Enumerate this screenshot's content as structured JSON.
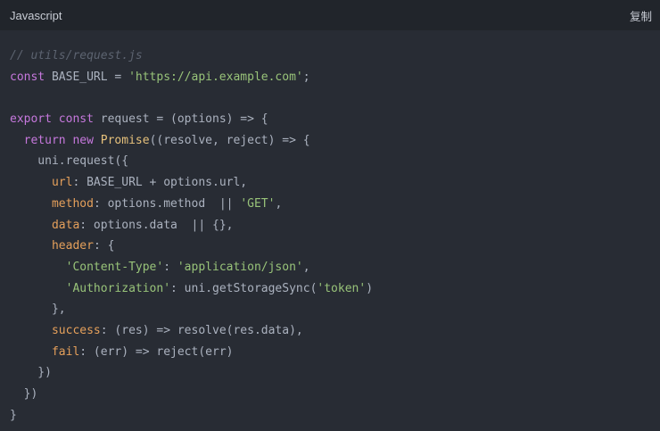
{
  "header": {
    "language": "Javascript",
    "copy_label": "复制"
  },
  "colors": {
    "background": "#282c34",
    "header_background": "#21252b",
    "comment": "#5c6370",
    "keyword": "#c678dd",
    "string": "#98c379",
    "property": "#e5a05b",
    "class": "#e5c07b",
    "plain": "#abb2bf"
  },
  "code": {
    "lines": [
      [
        {
          "t": "comment",
          "v": "// utils/request.js"
        }
      ],
      [
        {
          "t": "keyword",
          "v": "const"
        },
        {
          "t": "plain",
          "v": " BASE_URL = "
        },
        {
          "t": "string",
          "v": "'https://api.example.com'"
        },
        {
          "t": "plain",
          "v": ";"
        }
      ],
      [],
      [
        {
          "t": "keyword",
          "v": "export"
        },
        {
          "t": "plain",
          "v": " "
        },
        {
          "t": "keyword",
          "v": "const"
        },
        {
          "t": "plain",
          "v": " request = (options) => {"
        }
      ],
      [
        {
          "t": "plain",
          "v": "  "
        },
        {
          "t": "keyword",
          "v": "return"
        },
        {
          "t": "plain",
          "v": " "
        },
        {
          "t": "keyword",
          "v": "new"
        },
        {
          "t": "plain",
          "v": " "
        },
        {
          "t": "class",
          "v": "Promise"
        },
        {
          "t": "plain",
          "v": "((resolve, reject) => {"
        }
      ],
      [
        {
          "t": "plain",
          "v": "    uni.request({"
        }
      ],
      [
        {
          "t": "plain",
          "v": "      "
        },
        {
          "t": "prop",
          "v": "url"
        },
        {
          "t": "plain",
          "v": ": BASE_URL + options.url,"
        }
      ],
      [
        {
          "t": "plain",
          "v": "      "
        },
        {
          "t": "prop",
          "v": "method"
        },
        {
          "t": "plain",
          "v": ": options.method  || "
        },
        {
          "t": "string",
          "v": "'GET'"
        },
        {
          "t": "plain",
          "v": ","
        }
      ],
      [
        {
          "t": "plain",
          "v": "      "
        },
        {
          "t": "prop",
          "v": "data"
        },
        {
          "t": "plain",
          "v": ": options.data  || {},"
        }
      ],
      [
        {
          "t": "plain",
          "v": "      "
        },
        {
          "t": "prop",
          "v": "header"
        },
        {
          "t": "plain",
          "v": ": {"
        }
      ],
      [
        {
          "t": "plain",
          "v": "        "
        },
        {
          "t": "string",
          "v": "'Content-Type'"
        },
        {
          "t": "plain",
          "v": ": "
        },
        {
          "t": "string",
          "v": "'application/json'"
        },
        {
          "t": "plain",
          "v": ","
        }
      ],
      [
        {
          "t": "plain",
          "v": "        "
        },
        {
          "t": "string",
          "v": "'Authorization'"
        },
        {
          "t": "plain",
          "v": ": uni.getStorageSync("
        },
        {
          "t": "string",
          "v": "'token'"
        },
        {
          "t": "plain",
          "v": ")"
        }
      ],
      [
        {
          "t": "plain",
          "v": "      },"
        }
      ],
      [
        {
          "t": "plain",
          "v": "      "
        },
        {
          "t": "prop",
          "v": "success"
        },
        {
          "t": "plain",
          "v": ": (res) => resolve(res.data),"
        }
      ],
      [
        {
          "t": "plain",
          "v": "      "
        },
        {
          "t": "prop",
          "v": "fail"
        },
        {
          "t": "plain",
          "v": ": (err) => reject(err)"
        }
      ],
      [
        {
          "t": "plain",
          "v": "    })"
        }
      ],
      [
        {
          "t": "plain",
          "v": "  })"
        }
      ],
      [
        {
          "t": "plain",
          "v": "}"
        }
      ]
    ]
  }
}
